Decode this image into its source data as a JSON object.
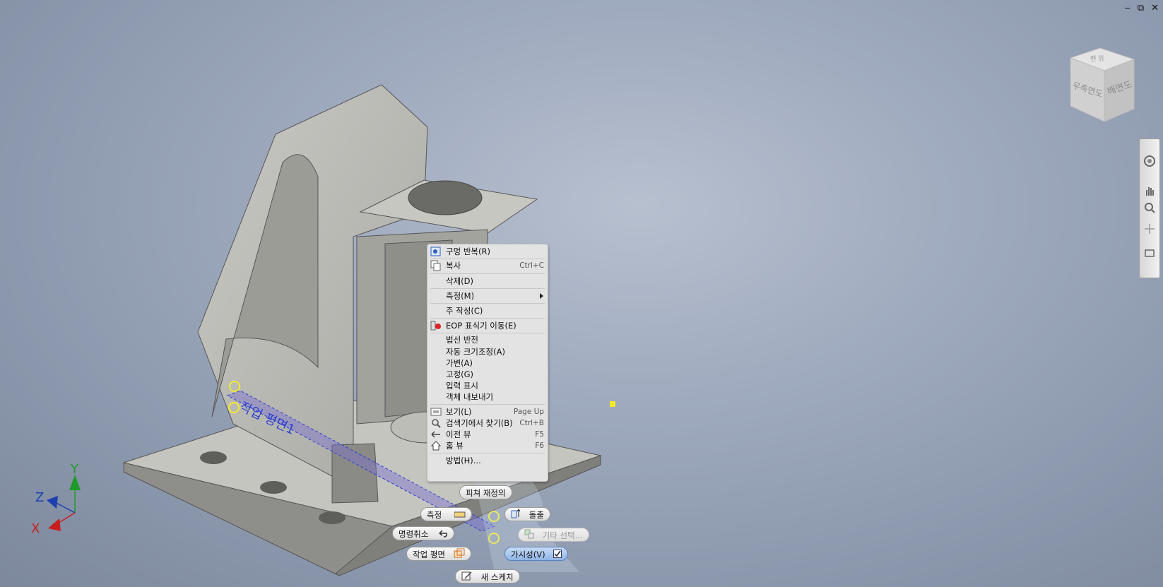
{
  "window_controls": {
    "minimize": "‒",
    "restore": "⧉",
    "close": "✕"
  },
  "viewcube": {
    "top_label": "맨 위",
    "left_label": "우측면도",
    "right_label": "배면도"
  },
  "model": {
    "plane_label": "작업 평면1"
  },
  "axes": {
    "x": "X",
    "y": "Y",
    "z": "Z"
  },
  "context_menu": {
    "items": [
      {
        "label": "구멍 반복(R)",
        "shortcut": ""
      },
      {
        "label": "복사",
        "shortcut": "Ctrl+C"
      },
      {
        "label": "삭제(D)",
        "shortcut": ""
      },
      {
        "label": "측정(M)",
        "shortcut": ""
      },
      {
        "label": "주 작성(C)",
        "shortcut": ""
      },
      {
        "label": "EOP 표식기 이동(E)",
        "shortcut": ""
      },
      {
        "label": "법선 반전",
        "shortcut": ""
      },
      {
        "label": "자동 크기조정(A)",
        "shortcut": ""
      },
      {
        "label": "가변(A)",
        "shortcut": ""
      },
      {
        "label": "고정(G)",
        "shortcut": ""
      },
      {
        "label": "입력 표시",
        "shortcut": ""
      },
      {
        "label": "객체 내보내기",
        "shortcut": ""
      },
      {
        "label": "보기(L)",
        "shortcut": "Page Up"
      },
      {
        "label": "검색기에서 찾기(B)",
        "shortcut": "Ctrl+B"
      },
      {
        "label": "이전 뷰",
        "shortcut": "F5"
      },
      {
        "label": "홈 뷰",
        "shortcut": "F6"
      },
      {
        "label": "방법(H)...",
        "shortcut": ""
      }
    ]
  },
  "marking_menu": {
    "redefine": "피쳐 재정의",
    "measure": "측정",
    "extrude": "돌출",
    "undo": "명령취소",
    "other_select": "기타 선택...",
    "work_plane": "작업 평면",
    "visibility": "가시성(V)",
    "new_sketch": "새 스케치"
  },
  "colors": {
    "accent_blue": "#2d5fc4",
    "highlight_yellow": "#f2ea2a",
    "axis_x": "#c81e1e",
    "axis_y": "#1f9a2a",
    "axis_z": "#1c3fb0"
  }
}
